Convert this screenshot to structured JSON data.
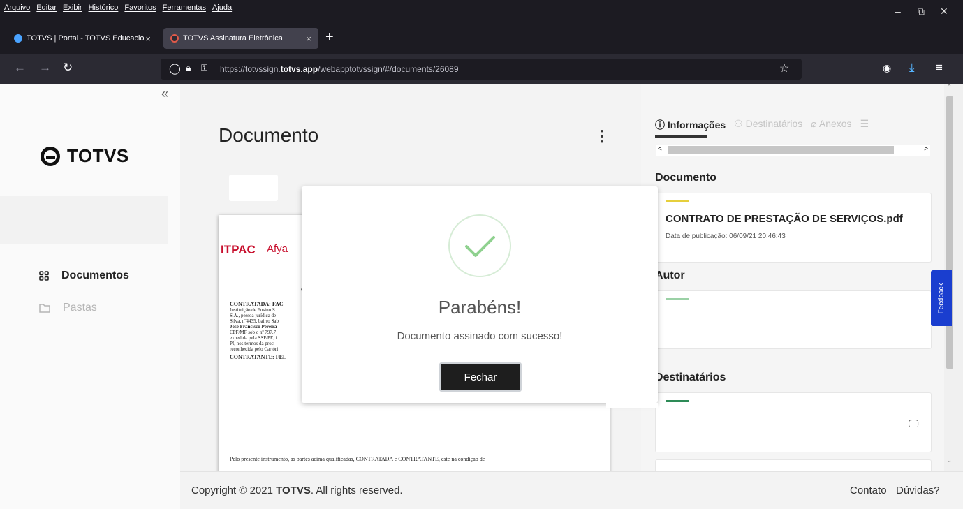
{
  "browser": {
    "menu": [
      "Arquivo",
      "Editar",
      "Exibir",
      "Histórico",
      "Favoritos",
      "Ferramentas",
      "Ajuda"
    ],
    "tabs": [
      {
        "title": "TOTVS | Portal - TOTVS Educacio",
        "close": "×"
      },
      {
        "title": "TOTVS Assinatura Eletrônica",
        "close": "×"
      }
    ],
    "new_tab": "+",
    "url_prefix": "https://totvssign.",
    "url_domain": "totvs.app",
    "url_suffix": "/webapptotvssign/#/documents/26089",
    "window_controls": {
      "minimize": "–",
      "restore": "⧉",
      "close": "✕"
    }
  },
  "sidebar": {
    "collapse": "«",
    "logo": "TOTVS",
    "items": [
      {
        "label": "Documentos",
        "active": true
      },
      {
        "label": "Pastas",
        "active": false
      }
    ]
  },
  "main": {
    "title": "Documento",
    "menu_glyph": "⋮",
    "preview": {
      "logo_left": "ITPAC",
      "logo_right": "Afya",
      "header_letter": "C",
      "party1": "CONTRATADA: FAC",
      "lines": [
        "Instituição de Ensino S",
        "S.A., pessoa jurídica de",
        "Silva, nº4435, bairro Sab",
        "José Francisco Pereira",
        "CPF/MF sob o nº 797.7",
        "expedida pela SSP/PE, i",
        "PI, nos termos da proc",
        "reconhecida pelo Cartóri"
      ],
      "party2": "CONTRATANTE: FEL",
      "bottom": "Pelo presente instrumento, as partes acima qualificadas, CONTRATADA e CONTRATANTE, este na condição de"
    }
  },
  "right": {
    "tabs": [
      "Informações",
      "Destinatários",
      "Anexos"
    ],
    "scroll_left": "<",
    "scroll_right": ">",
    "document_heading": "Documento",
    "file_name": "CONTRATO DE PRESTAÇÃO DE SERVIÇOS.pdf",
    "published": "Data de publicação: 06/09/21 20:46:43",
    "author_heading": "Autor",
    "recipients_heading": "Destinatários"
  },
  "feedback": "Feedback",
  "footer": {
    "copyright_prefix": "Copyright © 2021 ",
    "copyright_brand": "TOTVS",
    "copyright_suffix": ". All rights reserved.",
    "contact": "Contato",
    "help": "Dúvidas?"
  },
  "modal": {
    "title": "Parabéns!",
    "message": "Documento assinado com sucesso!",
    "button": "Fechar"
  },
  "colors": {
    "accent_green": "#8fd18f",
    "bar_yellow": "#e6cf3c",
    "bar_green": "#2e8b57",
    "feedback_blue": "#1a3ecf"
  }
}
